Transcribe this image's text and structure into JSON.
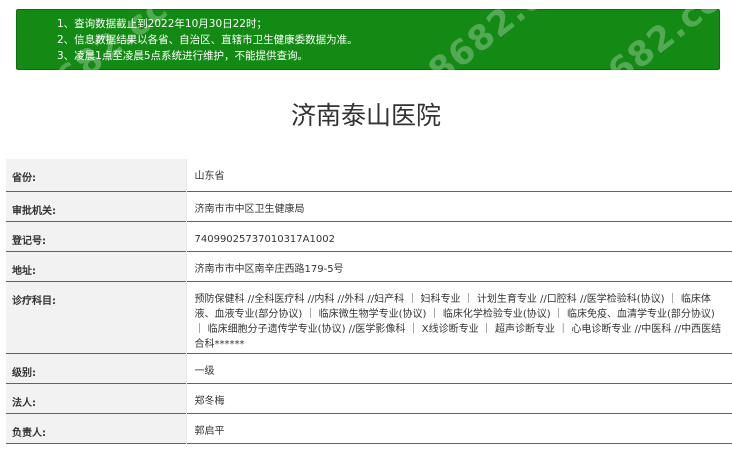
{
  "notice": {
    "lines": [
      "1、查询数据截止到2022年10月30日22时；",
      "2、信息数据结果以各省、自治区、直辖市卫生健康委数据为准。",
      "3、凌晨1点至凌晨5点系统进行维护，不能提供查询。"
    ],
    "watermark": "8682.cc"
  },
  "hospital": {
    "name": "济南泰山医院"
  },
  "rows": [
    {
      "label": "省份:",
      "value": "山东省"
    },
    {
      "label": "审批机关:",
      "value": "济南市市中区卫生健康局"
    },
    {
      "label": "登记号:",
      "value": "74099025737010317A1002"
    },
    {
      "label": "地址:",
      "value": "济南市市中区南辛庄西路179-5号"
    },
    {
      "label": "诊疗科目:",
      "value": "预防保健科 //全科医疗科 //内科 //外科 //妇产科 ｜ 妇科专业 ｜ 计划生育专业 //口腔科 //医学检验科(协议) ｜ 临床体液、血液专业(部分协议) ｜ 临床微生物学专业(协议) ｜ 临床化学检验专业(协议) ｜ 临床免疫、血清学专业(部分协议) ｜ 临床细胞分子遗传学专业(协议) //医学影像科 ｜ X线诊断专业 ｜ 超声诊断专业 ｜ 心电诊断专业 //中医科 //中西医结合科******"
    },
    {
      "label": "级别:",
      "value": "一级"
    },
    {
      "label": "法人:",
      "value": "郑冬梅"
    },
    {
      "label": "负责人:",
      "value": "郭启平"
    }
  ],
  "colors": {
    "notice_bg": "#138a13",
    "divider": "#3f7d3f",
    "label_bg": "#f2f2f2"
  }
}
